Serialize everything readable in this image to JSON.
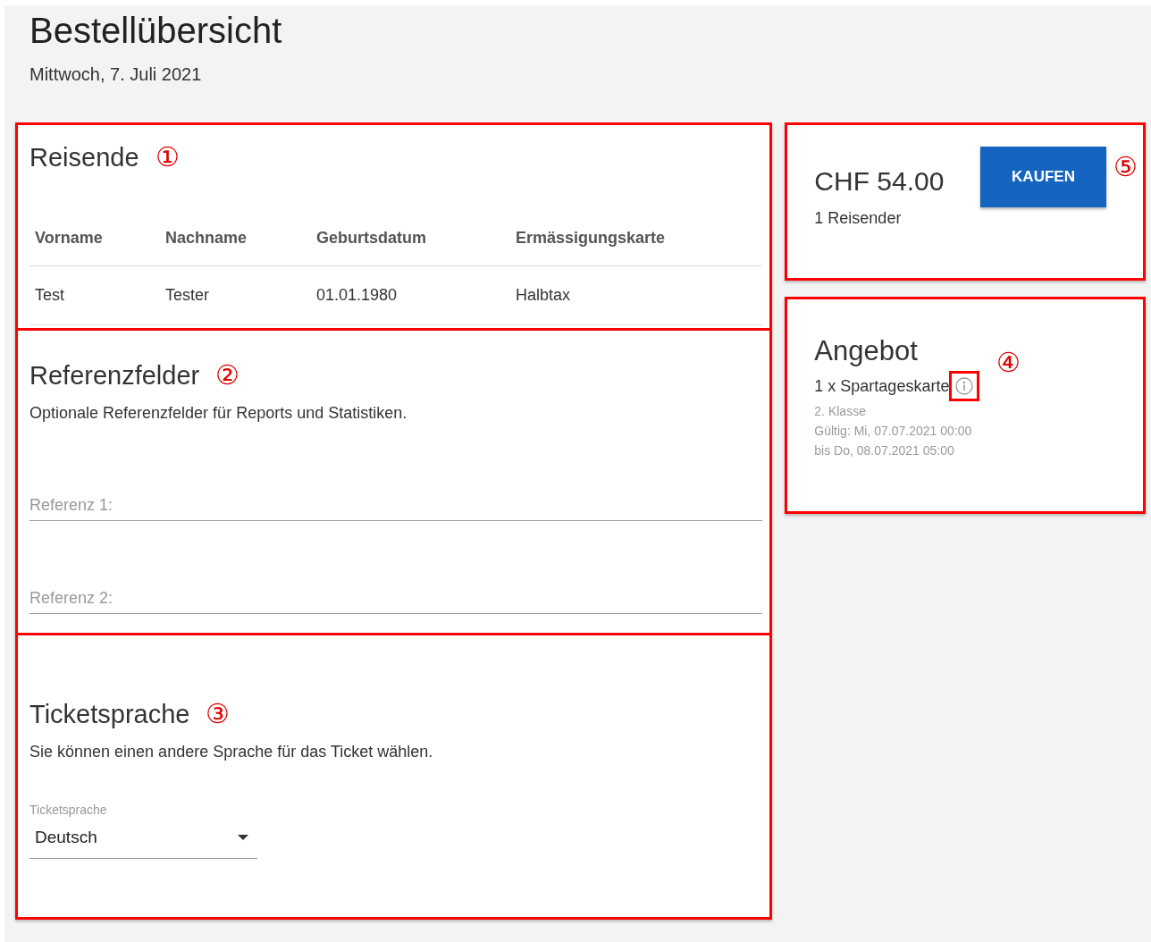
{
  "page": {
    "title": "Bestellübersicht",
    "date": "Mittwoch, 7. Juli 2021"
  },
  "travellers": {
    "title": "Reisende",
    "marker": "①",
    "highlighted": true,
    "columns": [
      "Vorname",
      "Nachname",
      "Geburtsdatum",
      "Ermässigungskarte"
    ],
    "rows": [
      [
        "Test",
        "Tester",
        "01.01.1980",
        "Halbtax"
      ]
    ]
  },
  "reference_fields": {
    "title": "Referenzfelder",
    "marker": "②",
    "highlighted": true,
    "description": "Optionale Referenzfelder für Reports und Statistiken.",
    "fields": [
      {
        "placeholder": "Referenz 1:"
      },
      {
        "placeholder": "Referenz 2:"
      }
    ]
  },
  "ticket_language": {
    "title": "Ticketsprache",
    "marker": "③",
    "highlighted": true,
    "description": "Sie können einen andere Sprache für das Ticket wählen.",
    "select": {
      "label": "Ticketsprache",
      "value": "Deutsch"
    }
  },
  "summary": {
    "price": "CHF 54.00",
    "travellers": "1 Reisender",
    "button": "KAUFEN",
    "marker": "⑤",
    "highlighted": true
  },
  "offer": {
    "title": "Angebot",
    "marker": "④",
    "highlighted": true,
    "product": "1 x Spartageskarte",
    "info_highlighted": true,
    "details": [
      "2. Klasse",
      "Gültig: Mi, 07.07.2021 00:00",
      "bis Do, 08.07.2021 05:00"
    ]
  }
}
